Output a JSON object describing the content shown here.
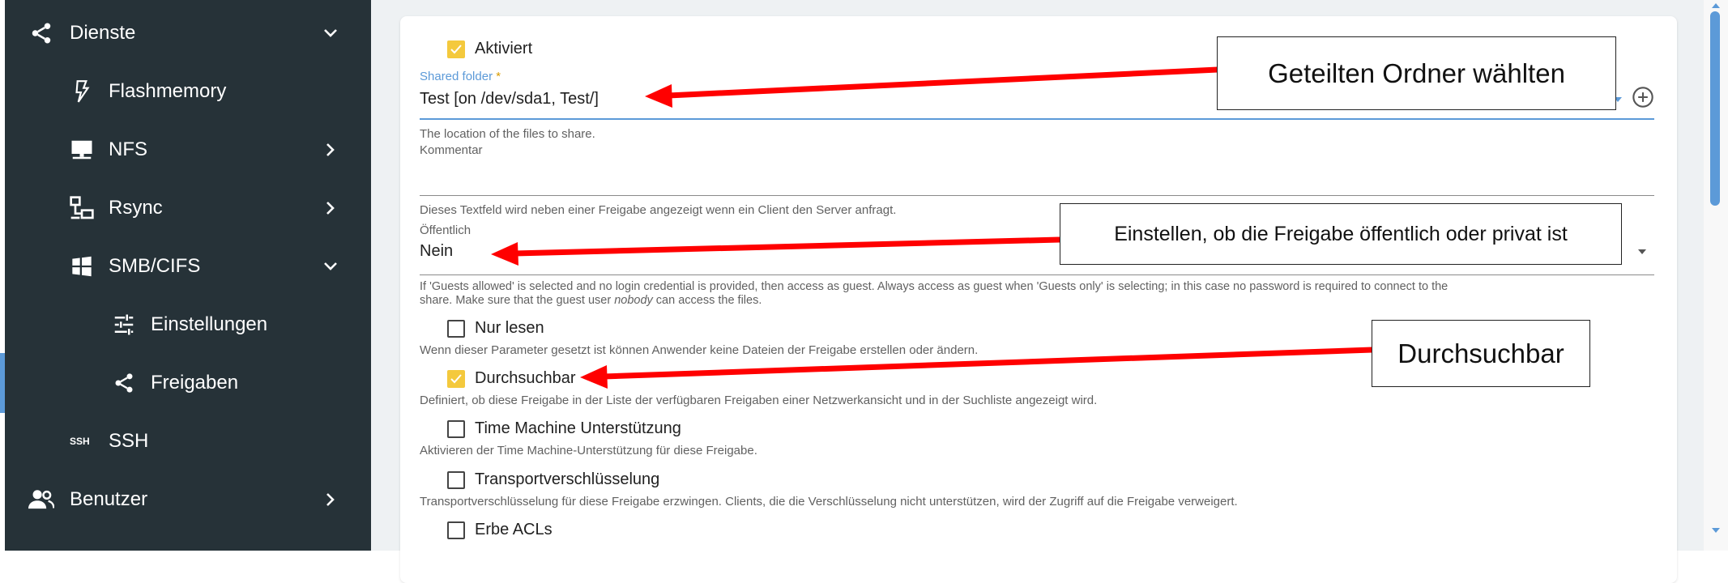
{
  "sidebar": {
    "items": [
      {
        "label": "Dienste",
        "icon": "share-icon"
      },
      {
        "label": "Flashmemory",
        "icon": "flash-icon"
      },
      {
        "label": "NFS",
        "icon": "monitor-icon"
      },
      {
        "label": "Rsync",
        "icon": "network-icon"
      },
      {
        "label": "SMB/CIFS",
        "icon": "windows-icon"
      },
      {
        "label": "Einstellungen",
        "icon": "tune-icon"
      },
      {
        "label": "Freigaben",
        "icon": "share-icon"
      },
      {
        "label": "SSH",
        "icon": "ssh-icon",
        "icon_text": "SSH"
      },
      {
        "label": "Benutzer",
        "icon": "users-icon"
      }
    ]
  },
  "form": {
    "enabled_label": "Aktiviert",
    "shared_folder": {
      "label": "Shared folder",
      "required": "*",
      "value": "Test [on /dev/sda1, Test/]",
      "hint": "The location of the files to share."
    },
    "comment": {
      "label": "Kommentar",
      "value": "",
      "hint": "Dieses Textfeld wird neben einer Freigabe angezeigt wenn ein Client den Server anfragt."
    },
    "public": {
      "label": "Öffentlich",
      "value": "Nein",
      "hint_line1": "If 'Guests allowed' is selected and no login credential is provided, then access as guest. Always access as guest when 'Guests only' is selecting; in this case no password is required to connect to the",
      "hint_line2_pre": "share. Make sure that the guest user ",
      "hint_line2_em": "nobody",
      "hint_line2_post": " can access the files."
    },
    "read_only": {
      "label": "Nur lesen",
      "checked": false,
      "hint": "Wenn dieser Parameter gesetzt ist können Anwender keine Dateien der Freigabe erstellen oder ändern."
    },
    "browseable": {
      "label": "Durchsuchbar",
      "checked": true,
      "hint": "Definiert, ob diese Freigabe in der Liste der verfügbaren Freigaben einer Netzwerkansicht und in der Suchliste angezeigt wird."
    },
    "time_machine": {
      "label": "Time Machine Unterstützung",
      "checked": false,
      "hint": "Aktivieren der Time Machine-Unterstützung für diese Freigabe."
    },
    "transport_enc": {
      "label": "Transportverschlüsselung",
      "checked": false,
      "hint": "Transportverschlüsselung für diese Freigabe erzwingen. Clients, die die Verschlüsselung nicht unterstützen, wird der Zugriff auf die Freigabe verweigert."
    },
    "inherit_acls": {
      "label": "Erbe ACLs",
      "checked": false
    }
  },
  "callouts": {
    "c1": "Geteilten Ordner wählten",
    "c2": "Einstellen, ob die Freigabe öffentlich oder privat ist",
    "c3": "Durchsuchbar"
  },
  "colors": {
    "sidebar_bg": "#263238",
    "accent_yellow": "#f4c93d",
    "focus_blue": "#5c9ad8",
    "arrow_red": "#ff0000"
  }
}
